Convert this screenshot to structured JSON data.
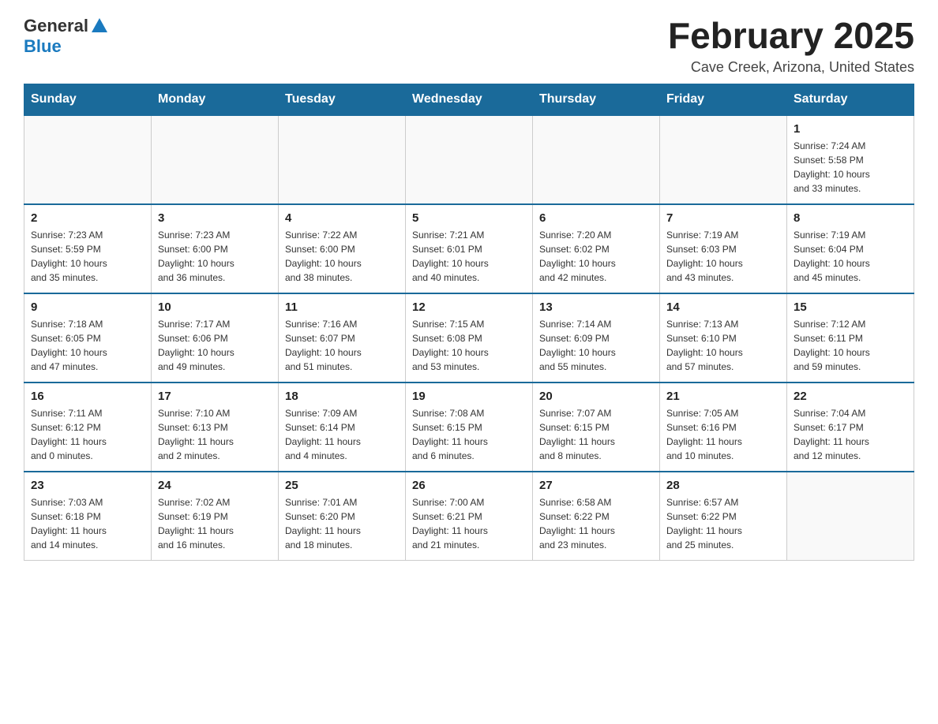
{
  "logo": {
    "general": "General",
    "blue": "Blue"
  },
  "title": "February 2025",
  "location": "Cave Creek, Arizona, United States",
  "days_of_week": [
    "Sunday",
    "Monday",
    "Tuesday",
    "Wednesday",
    "Thursday",
    "Friday",
    "Saturday"
  ],
  "weeks": [
    [
      {
        "day": "",
        "info": ""
      },
      {
        "day": "",
        "info": ""
      },
      {
        "day": "",
        "info": ""
      },
      {
        "day": "",
        "info": ""
      },
      {
        "day": "",
        "info": ""
      },
      {
        "day": "",
        "info": ""
      },
      {
        "day": "1",
        "info": "Sunrise: 7:24 AM\nSunset: 5:58 PM\nDaylight: 10 hours\nand 33 minutes."
      }
    ],
    [
      {
        "day": "2",
        "info": "Sunrise: 7:23 AM\nSunset: 5:59 PM\nDaylight: 10 hours\nand 35 minutes."
      },
      {
        "day": "3",
        "info": "Sunrise: 7:23 AM\nSunset: 6:00 PM\nDaylight: 10 hours\nand 36 minutes."
      },
      {
        "day": "4",
        "info": "Sunrise: 7:22 AM\nSunset: 6:00 PM\nDaylight: 10 hours\nand 38 minutes."
      },
      {
        "day": "5",
        "info": "Sunrise: 7:21 AM\nSunset: 6:01 PM\nDaylight: 10 hours\nand 40 minutes."
      },
      {
        "day": "6",
        "info": "Sunrise: 7:20 AM\nSunset: 6:02 PM\nDaylight: 10 hours\nand 42 minutes."
      },
      {
        "day": "7",
        "info": "Sunrise: 7:19 AM\nSunset: 6:03 PM\nDaylight: 10 hours\nand 43 minutes."
      },
      {
        "day": "8",
        "info": "Sunrise: 7:19 AM\nSunset: 6:04 PM\nDaylight: 10 hours\nand 45 minutes."
      }
    ],
    [
      {
        "day": "9",
        "info": "Sunrise: 7:18 AM\nSunset: 6:05 PM\nDaylight: 10 hours\nand 47 minutes."
      },
      {
        "day": "10",
        "info": "Sunrise: 7:17 AM\nSunset: 6:06 PM\nDaylight: 10 hours\nand 49 minutes."
      },
      {
        "day": "11",
        "info": "Sunrise: 7:16 AM\nSunset: 6:07 PM\nDaylight: 10 hours\nand 51 minutes."
      },
      {
        "day": "12",
        "info": "Sunrise: 7:15 AM\nSunset: 6:08 PM\nDaylight: 10 hours\nand 53 minutes."
      },
      {
        "day": "13",
        "info": "Sunrise: 7:14 AM\nSunset: 6:09 PM\nDaylight: 10 hours\nand 55 minutes."
      },
      {
        "day": "14",
        "info": "Sunrise: 7:13 AM\nSunset: 6:10 PM\nDaylight: 10 hours\nand 57 minutes."
      },
      {
        "day": "15",
        "info": "Sunrise: 7:12 AM\nSunset: 6:11 PM\nDaylight: 10 hours\nand 59 minutes."
      }
    ],
    [
      {
        "day": "16",
        "info": "Sunrise: 7:11 AM\nSunset: 6:12 PM\nDaylight: 11 hours\nand 0 minutes."
      },
      {
        "day": "17",
        "info": "Sunrise: 7:10 AM\nSunset: 6:13 PM\nDaylight: 11 hours\nand 2 minutes."
      },
      {
        "day": "18",
        "info": "Sunrise: 7:09 AM\nSunset: 6:14 PM\nDaylight: 11 hours\nand 4 minutes."
      },
      {
        "day": "19",
        "info": "Sunrise: 7:08 AM\nSunset: 6:15 PM\nDaylight: 11 hours\nand 6 minutes."
      },
      {
        "day": "20",
        "info": "Sunrise: 7:07 AM\nSunset: 6:15 PM\nDaylight: 11 hours\nand 8 minutes."
      },
      {
        "day": "21",
        "info": "Sunrise: 7:05 AM\nSunset: 6:16 PM\nDaylight: 11 hours\nand 10 minutes."
      },
      {
        "day": "22",
        "info": "Sunrise: 7:04 AM\nSunset: 6:17 PM\nDaylight: 11 hours\nand 12 minutes."
      }
    ],
    [
      {
        "day": "23",
        "info": "Sunrise: 7:03 AM\nSunset: 6:18 PM\nDaylight: 11 hours\nand 14 minutes."
      },
      {
        "day": "24",
        "info": "Sunrise: 7:02 AM\nSunset: 6:19 PM\nDaylight: 11 hours\nand 16 minutes."
      },
      {
        "day": "25",
        "info": "Sunrise: 7:01 AM\nSunset: 6:20 PM\nDaylight: 11 hours\nand 18 minutes."
      },
      {
        "day": "26",
        "info": "Sunrise: 7:00 AM\nSunset: 6:21 PM\nDaylight: 11 hours\nand 21 minutes."
      },
      {
        "day": "27",
        "info": "Sunrise: 6:58 AM\nSunset: 6:22 PM\nDaylight: 11 hours\nand 23 minutes."
      },
      {
        "day": "28",
        "info": "Sunrise: 6:57 AM\nSunset: 6:22 PM\nDaylight: 11 hours\nand 25 minutes."
      },
      {
        "day": "",
        "info": ""
      }
    ]
  ]
}
